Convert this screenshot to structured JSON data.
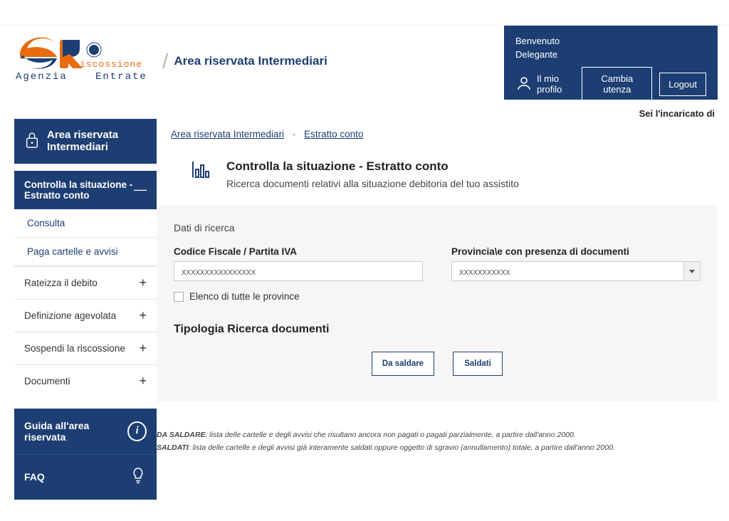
{
  "header": {
    "page_name": "Area riservata Intermediari",
    "welcome": "Benvenuto",
    "role": "Delegante",
    "profile_label": "Il mio profilo",
    "change_user": "Cambia utenza",
    "logout": "Logout",
    "right_note": "Sei l'incaricato di"
  },
  "breadcrumb": {
    "root": "Area riservata Intermediari",
    "sep": "-",
    "current": "Estratto conto"
  },
  "sidebar": {
    "title": "Area riservata Intermediari",
    "items": [
      {
        "label": "Controlla la situazione - Estratto conto",
        "toggle": "—"
      },
      {
        "label": "Consulta"
      },
      {
        "label": "Paga cartelle e avvisi"
      },
      {
        "label": "Rateizza il debito",
        "toggle": "+"
      },
      {
        "label": "Definizione agevolata",
        "toggle": "+"
      },
      {
        "label": "Sospendi la riscossione",
        "toggle": "+"
      },
      {
        "label": "Documenti",
        "toggle": "+"
      }
    ],
    "help1": "Guida all'area riservata",
    "help2": "FAQ"
  },
  "main": {
    "title": "Controlla la situazione - Estratto conto",
    "subtitle": "Ricerca documenti relativi alla situazione debitoria del tuo assistito",
    "panel_label": "Dati di ricerca",
    "cf_label": "Codice Fiscale / Partita IVA",
    "cf_value": "xxxxxxxxxxxxxxxx",
    "prov_label": "Provincia\\e con presenza di documenti",
    "prov_value": "xxxxxxxxxxx",
    "all_prov": "Elenco di tutte le province",
    "tipologia_label": "Tipologia Ricerca documenti",
    "btn_da_saldare": "Da saldare",
    "btn_saldati": "Saldati",
    "notes": {
      "line1_head": "DA SALDARE",
      "line1_body": ": lista delle cartelle e degli avvisi che risultano ancora non pagati o pagati parzialmente, a partire dall'anno 2000.",
      "line2_head": "SALDATI",
      "line2_body": ": lista delle cartelle e degli avvisi già interamente saldati oppure oggetto di sgravio (annullamento) totale, a partire dall'anno 2000."
    }
  }
}
